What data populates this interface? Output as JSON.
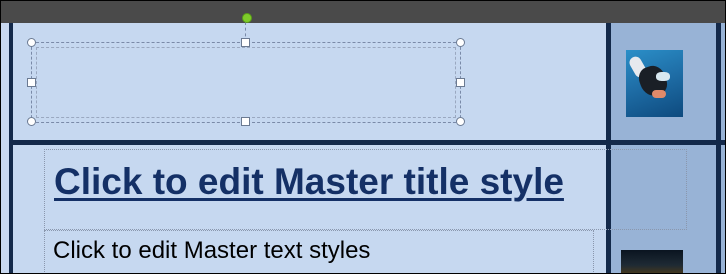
{
  "slide": {
    "title_placeholder": "Click to edit Master title style",
    "body_placeholder": "Click to edit Master text styles"
  },
  "images": [
    {
      "name": "diver-picture"
    },
    {
      "name": "underwater-picture"
    }
  ]
}
